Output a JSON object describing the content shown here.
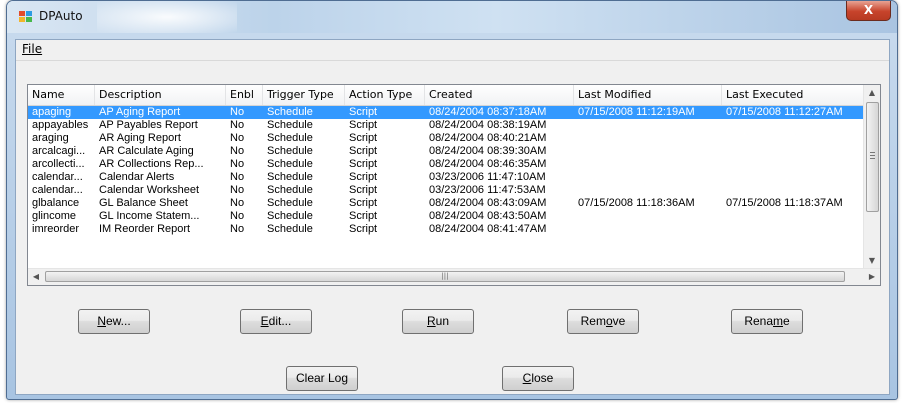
{
  "window": {
    "title": "DPAuto",
    "close_glyph": "X"
  },
  "menu": {
    "file_label": "File"
  },
  "list": {
    "columns": [
      "Name",
      "Description",
      "Enbl",
      "Trigger Type",
      "Action Type",
      "Created",
      "Last Modified",
      "Last Executed"
    ],
    "rows": [
      {
        "name": "apaging",
        "description": "AP Aging Report",
        "enbl": "No",
        "trigger": "Schedule",
        "action": "Script",
        "created": "08/24/2004 08:37:18AM",
        "modified": "07/15/2008 11:12:19AM",
        "executed": "07/15/2008 11:12:27AM",
        "selected": true
      },
      {
        "name": "appayables",
        "description": "AP Payables Report",
        "enbl": "No",
        "trigger": "Schedule",
        "action": "Script",
        "created": "08/24/2004 08:38:19AM",
        "modified": "",
        "executed": ""
      },
      {
        "name": "araging",
        "description": "AR Aging Report",
        "enbl": "No",
        "trigger": "Schedule",
        "action": "Script",
        "created": "08/24/2004 08:40:21AM",
        "modified": "",
        "executed": ""
      },
      {
        "name": "arcalcagi...",
        "description": "AR Calculate Aging",
        "enbl": "No",
        "trigger": "Schedule",
        "action": "Script",
        "created": "08/24/2004 08:39:30AM",
        "modified": "",
        "executed": ""
      },
      {
        "name": "arcollecti...",
        "description": "AR Collections Rep...",
        "enbl": "No",
        "trigger": "Schedule",
        "action": "Script",
        "created": "08/24/2004 08:46:35AM",
        "modified": "",
        "executed": ""
      },
      {
        "name": "calendar...",
        "description": "Calendar Alerts",
        "enbl": "No",
        "trigger": "Schedule",
        "action": "Script",
        "created": "03/23/2006 11:47:10AM",
        "modified": "",
        "executed": ""
      },
      {
        "name": "calendar...",
        "description": "Calendar Worksheet",
        "enbl": "No",
        "trigger": "Schedule",
        "action": "Script",
        "created": "03/23/2006 11:47:53AM",
        "modified": "",
        "executed": ""
      },
      {
        "name": "glbalance",
        "description": "GL Balance Sheet",
        "enbl": "No",
        "trigger": "Schedule",
        "action": "Script",
        "created": "08/24/2004 08:43:09AM",
        "modified": "07/15/2008 11:18:36AM",
        "executed": "07/15/2008 11:18:37AM"
      },
      {
        "name": "glincome",
        "description": "GL Income Statem...",
        "enbl": "No",
        "trigger": "Schedule",
        "action": "Script",
        "created": "08/24/2004 08:43:50AM",
        "modified": "",
        "executed": ""
      },
      {
        "name": "imreorder",
        "description": "IM Reorder Report",
        "enbl": "No",
        "trigger": "Schedule",
        "action": "Script",
        "created": "08/24/2004 08:41:47AM",
        "modified": "",
        "executed": ""
      }
    ]
  },
  "buttons": {
    "new": {
      "pre": "",
      "acc": "N",
      "post": "ew..."
    },
    "edit": {
      "pre": "",
      "acc": "E",
      "post": "dit..."
    },
    "run": {
      "pre": "",
      "acc": "R",
      "post": "un"
    },
    "remove": {
      "pre": "Rem",
      "acc": "o",
      "post": "ve"
    },
    "rename": {
      "pre": "Rena",
      "acc": "m",
      "post": "e"
    },
    "clear_log": "Clear  Log",
    "close": {
      "pre": "",
      "acc": "C",
      "post": "lose"
    }
  }
}
